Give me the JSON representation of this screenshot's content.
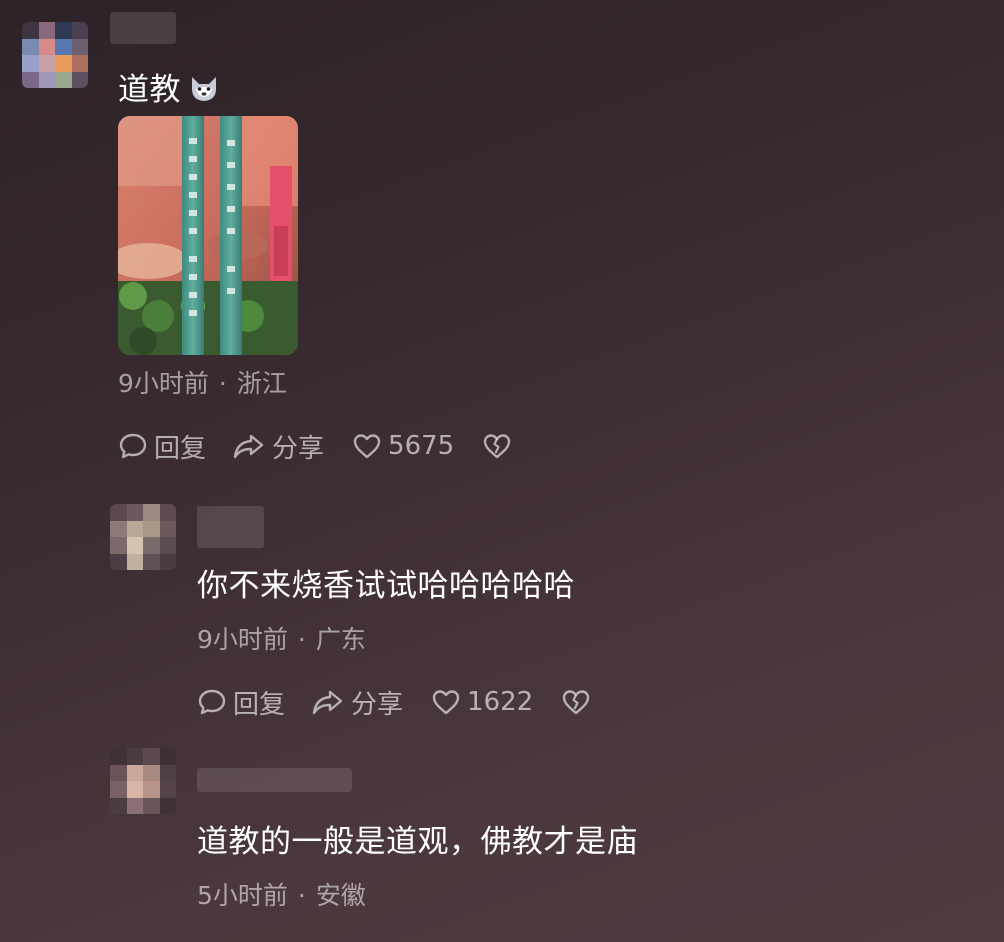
{
  "comments": [
    {
      "text": "道教",
      "emoji_icon": "wolf-face-icon",
      "time": "9小时前",
      "location": "浙江",
      "reply_label": "回复",
      "share_label": "分享",
      "likes": "5675",
      "image_icon": "incense-sticks-photo"
    },
    {
      "text": "你不来烧香试试哈哈哈哈哈",
      "time": "9小时前",
      "location": "广东",
      "reply_label": "回复",
      "share_label": "分享",
      "likes": "1622"
    },
    {
      "text": "道教的一般是道观，佛教才是庙",
      "time": "5小时前",
      "location": "安徽"
    }
  ],
  "meta_separator": "·",
  "icons": {
    "reply": "speech-bubble-icon",
    "share": "share-arrow-icon",
    "like": "heart-icon",
    "dislike": "broken-heart-icon"
  },
  "colors": {
    "background_top": "#2c2227",
    "background_bottom": "#4e3c3f",
    "text_primary": "#ffffff",
    "text_secondary": "#a89fa2"
  }
}
